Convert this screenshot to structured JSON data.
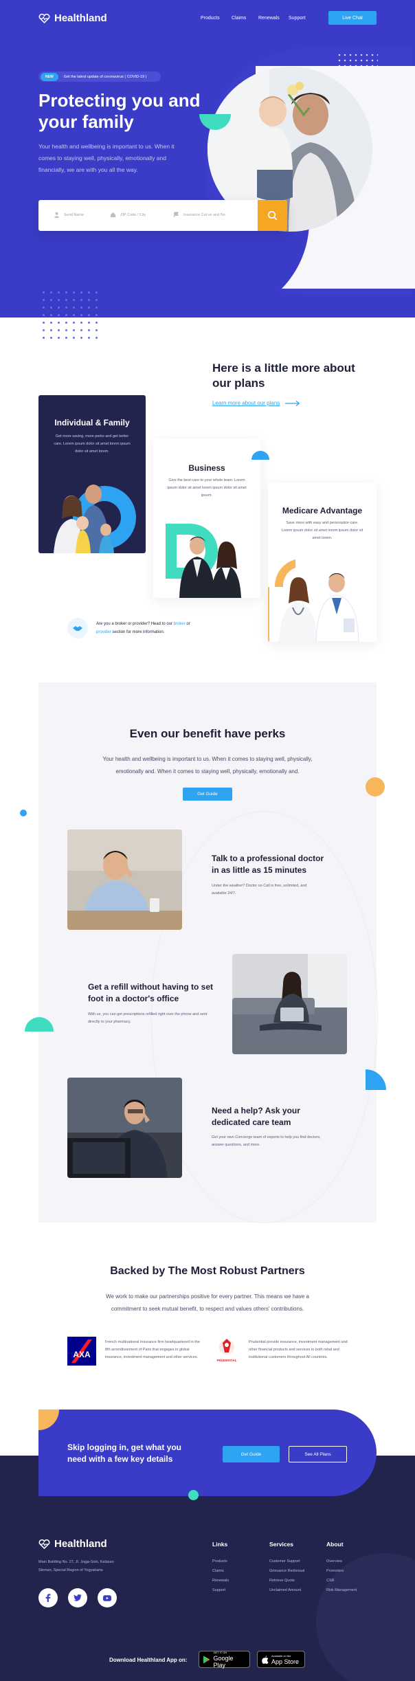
{
  "brand": {
    "name": "Healthland"
  },
  "nav": {
    "items": [
      "Products",
      "Claims",
      "Renewals",
      "Support"
    ],
    "cta": "Live Chat"
  },
  "hero": {
    "badge": "NEW",
    "announcement": "Get the latest update of coronavirus ( COVID-19 )",
    "title": "Protecting you and your family",
    "subtitle": "Your health and wellbeing is important to us. When it comes to staying well, physically, emotionally and financially, we are with you all the way.",
    "search": {
      "name_placeholder": "Send Name",
      "zip_placeholder": "ZIP Code / City",
      "plan_placeholder": "Insurance Cat ve and No"
    }
  },
  "plans": {
    "title": "Here is a little more about our plans",
    "link": "Learn more about our plans",
    "cards": [
      {
        "title": "Individual & Family",
        "text": "Get more saving, more perks and get better care. Lorem ipsum dolor sit amet lorem ipsum dolor sit amet lorem."
      },
      {
        "title": "Business",
        "text": "Give the best care to your whole team. Lorem ipsum dolor sit amet lorem ipsum dolor sit amet ipsum."
      },
      {
        "title": "Medicare Advantage",
        "text": "Save more with easy and personalize care. Lorem ipsum dolor sit amet lorem ipsum dolor sit amet lorem."
      }
    ],
    "broker_prefix": "Are you a broker or provider? Head to our",
    "broker_link1": "broker",
    "broker_or": "or",
    "broker_link2": "provider",
    "broker_suffix": "section for more information."
  },
  "perks": {
    "title": "Even our benefit have perks",
    "subtitle": "Your health and wellbeing is important to us. When it comes to staying well, physically, emotionally and. When it comes to staying well, physically, emotionally and.",
    "button": "Get Guide",
    "features": [
      {
        "title": "Talk to a professional doctor in as little as 15 minutes",
        "text": "Under the weather? Doctor on Call is free, unlimited, and available 24/7."
      },
      {
        "title": "Get a refill without having to set foot in a doctor's office",
        "text": "With us, you can get prescriptions refilled right over the phone and sent directly to your pharmacy."
      },
      {
        "title": "Need a help? Ask your dedicated care team",
        "text": "Get your own Concierge team of experts to help you find doctors, answer questions, and more."
      }
    ]
  },
  "partners": {
    "title": "Backed by The Most Robust Partners",
    "subtitle": "We work to make our partnerships positive for every partner.  This means we have a commitment to seek mutual benefit, to respect and values others' contributions.",
    "items": [
      {
        "logo": "AXA",
        "text": "French multinational insurance firm headquartered in the 8th arrondissement of Paris that engages in global insurance, investment management and other services."
      },
      {
        "logo": "PRUDENTIAL",
        "text": "Prudential provide insurance, investment management and other financial products and services to both retail and institutional customers throughout  All countries."
      }
    ]
  },
  "cta": {
    "title": "Skip logging in, get what you need with a few key details",
    "primary": "Get Guide",
    "secondary": "See All Plans"
  },
  "footer": {
    "address": "Main Building No. 27, Jl. Jogja-Solo, Kalasan Sleman, Special Region of Yogyakarta",
    "columns": [
      {
        "title": "Links",
        "items": [
          "Products",
          "Claims",
          "Renewals",
          "Support"
        ]
      },
      {
        "title": "Services",
        "items": [
          "Customer Support",
          "Grievance Redressal",
          "Retrieve Quote",
          "Unclaimed Amount"
        ]
      },
      {
        "title": "About",
        "items": [
          "Overview",
          "Promoters",
          "CSR",
          "Risk Management"
        ]
      }
    ],
    "download": "Download Healthland App on:",
    "google_small": "GET IT ON",
    "google_big": "Google Play",
    "apple_small": "Available on the",
    "apple_big": "App Store"
  },
  "colors": {
    "primary": "#3a3bc7",
    "accent": "#2ea3f2",
    "orange": "#f5a623",
    "teal": "#3fdcc0",
    "dark": "#23244e"
  }
}
